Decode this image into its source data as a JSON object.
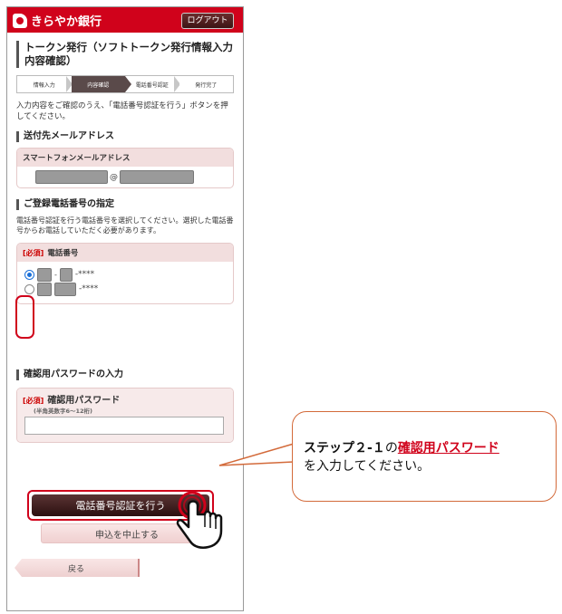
{
  "header": {
    "bank_name": "きらやか銀行",
    "logout_label": "ログアウト"
  },
  "page_title": "トークン発行（ソフトトークン発行情報入力内容確認）",
  "steps": [
    {
      "label": "情報入力"
    },
    {
      "label": "内容確認"
    },
    {
      "label": "電話番号認証"
    },
    {
      "label": "発行完了"
    }
  ],
  "intro_text": "入力内容をご確認のうえ、「電話番号認証を行う」ボタンを押してください。",
  "email_section": {
    "heading": "送付先メールアドレス",
    "card_title": "スマートフォンメールアドレス",
    "at_sign": "@"
  },
  "phone_section": {
    "heading": "ご登録電話番号の指定",
    "description": "電話番号認証を行う電話番号を選択してください。選択した電話番号からお電話していただく必要があります。",
    "required_tag": "[必須]",
    "card_title": "電話番号",
    "options": [
      {
        "masked": "-****",
        "selected": true
      },
      {
        "masked": "-****",
        "selected": false
      }
    ]
  },
  "password_section": {
    "heading": "確認用パスワードの入力",
    "required_tag": "[必須]",
    "label": "確認用パスワード",
    "hint": "(半角英数字6～12桁)",
    "value": ""
  },
  "buttons": {
    "verify_label": "電話番号認証を行う",
    "cancel_label": "申込を中止する",
    "back_label": "戻る"
  },
  "callout": {
    "prefix": "ステップ２-１",
    "particle": "の",
    "highlight": "確認用パスワード",
    "suffix": "を入力してください。"
  },
  "colors": {
    "brand_red": "#d0021b",
    "callout_border": "#d36a3a"
  }
}
